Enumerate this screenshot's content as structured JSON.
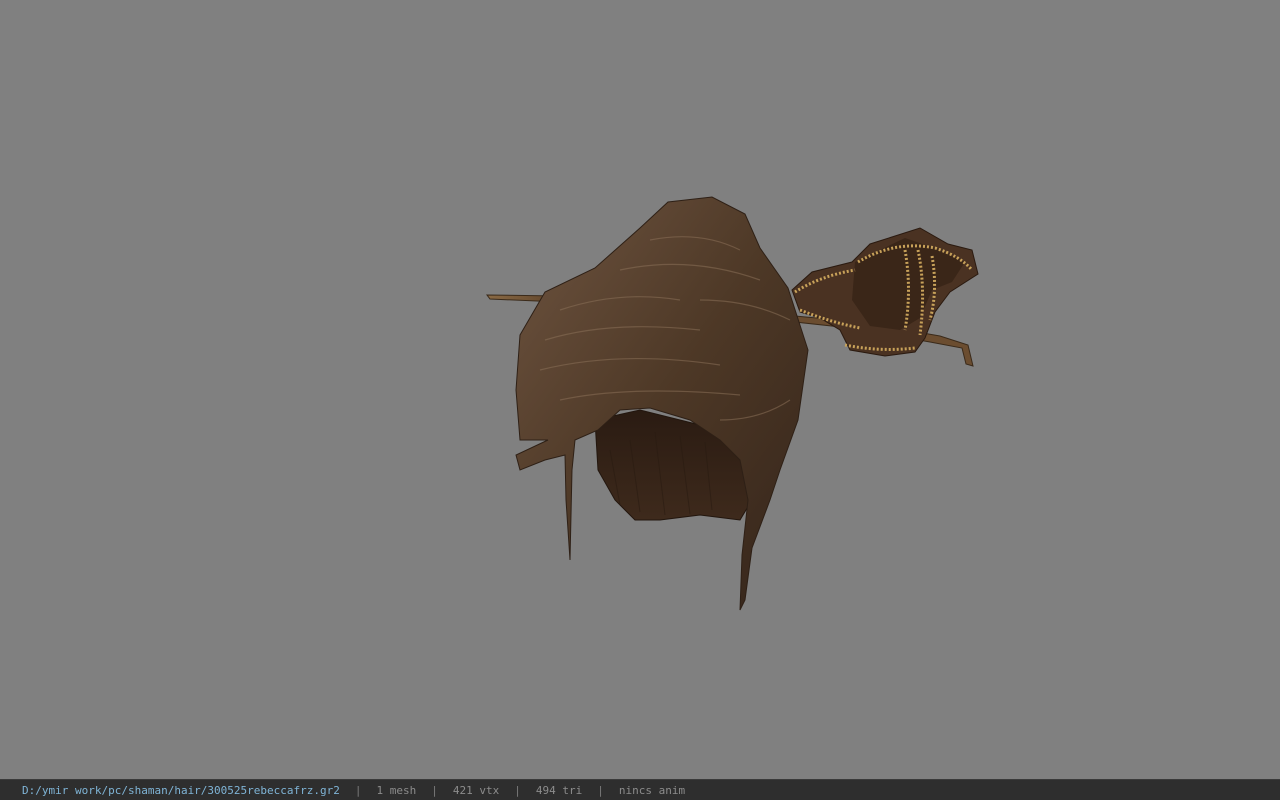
{
  "viewer": {
    "background_color": "#808080",
    "model_name": "hair-with-ornamented-hairpin"
  },
  "status": {
    "path": "D:/ymir work/pc/shaman/hair/300525rebeccafrz.gr2",
    "separator": "|",
    "mesh": "1 mesh",
    "vtx": "421 vtx",
    "tri": "494 tri",
    "anim": "nincs anim"
  }
}
